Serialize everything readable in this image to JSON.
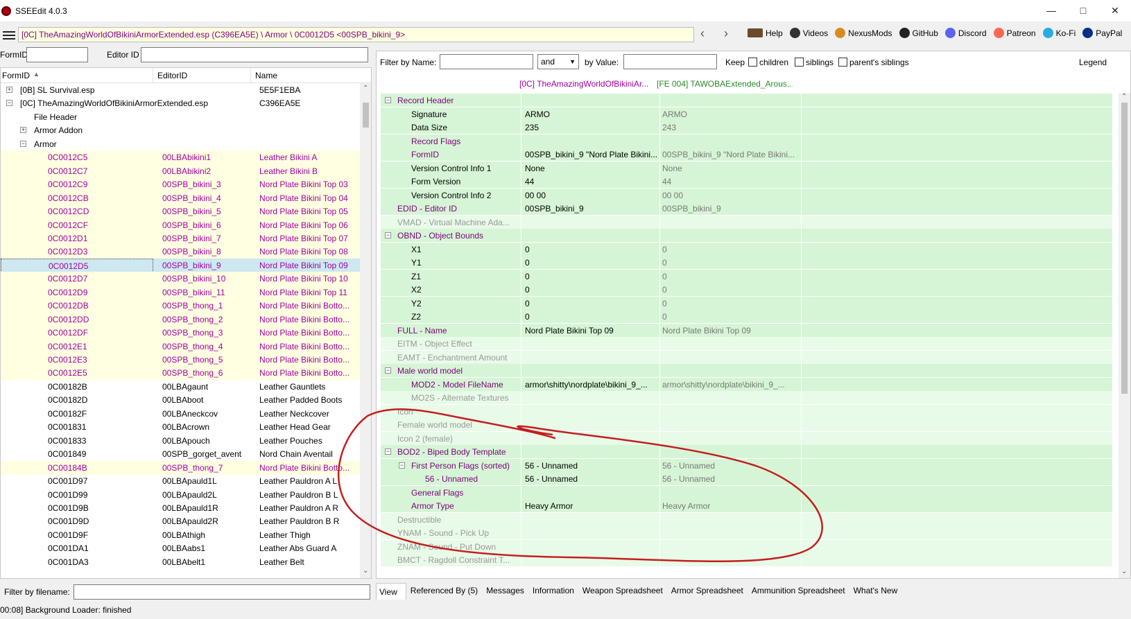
{
  "window": {
    "title": "SSEEdit 4.0.3"
  },
  "toolbar": {
    "path": "[0C] TheAmazingWorldOfBikiniArmorExtended.esp (C396EA5E) \\ Armor \\ 0C0012D5 <00SPB_bikini_9>",
    "links": [
      {
        "label": "Help",
        "icon": "book-icon",
        "color": "#6b4a2b"
      },
      {
        "label": "Videos",
        "icon": "video-icon",
        "color": "#333333"
      },
      {
        "label": "NexusMods",
        "icon": "nexus-icon",
        "color": "#d98c1e"
      },
      {
        "label": "GitHub",
        "icon": "github-icon",
        "color": "#222222"
      },
      {
        "label": "Discord",
        "icon": "discord-icon",
        "color": "#5865f2"
      },
      {
        "label": "Patreon",
        "icon": "patreon-icon",
        "color": "#f96854"
      },
      {
        "label": "Ko-Fi",
        "icon": "kofi-icon",
        "color": "#29abe0"
      },
      {
        "label": "PayPal",
        "icon": "paypal-icon",
        "color": "#003087"
      }
    ]
  },
  "left_filter": {
    "formid_label": "FormID",
    "editorid_label": "Editor ID"
  },
  "tree": {
    "columns": [
      "FormID",
      "EditorID",
      "Name"
    ],
    "rows": [
      {
        "c1": "[0B] SL Survival.esp",
        "c2": "",
        "c3": "5E5F1EBA",
        "level": 0,
        "exp": "+",
        "style": ""
      },
      {
        "c1": "[0C] TheAmazingWorldOfBikiniArmorExtended.esp",
        "c2": "",
        "c3": "C396EA5E",
        "level": 0,
        "exp": "−",
        "style": ""
      },
      {
        "c1": "File Header",
        "c2": "",
        "c3": "",
        "level": 1,
        "exp": "",
        "style": ""
      },
      {
        "c1": "Armor Addon",
        "c2": "",
        "c3": "",
        "level": 1,
        "exp": "+",
        "style": ""
      },
      {
        "c1": "Armor",
        "c2": "",
        "c3": "",
        "level": 1,
        "exp": "−",
        "style": ""
      },
      {
        "c1": "0C0012C5",
        "c2": "00LBAbikini1",
        "c3": "Leather Bikini A",
        "level": 2,
        "style": "yel pur"
      },
      {
        "c1": "0C0012C7",
        "c2": "00LBAbikini2",
        "c3": "Leather Bikini B",
        "level": 2,
        "style": "yel pur"
      },
      {
        "c1": "0C0012C9",
        "c2": "00SPB_bikini_3",
        "c3": "Nord Plate Bikini Top 03",
        "level": 2,
        "style": "yel pur"
      },
      {
        "c1": "0C0012CB",
        "c2": "00SPB_bikini_4",
        "c3": "Nord Plate Bikini Top 04",
        "level": 2,
        "style": "yel pur"
      },
      {
        "c1": "0C0012CD",
        "c2": "00SPB_bikini_5",
        "c3": "Nord Plate Bikini Top 05",
        "level": 2,
        "style": "yel pur"
      },
      {
        "c1": "0C0012CF",
        "c2": "00SPB_bikini_6",
        "c3": "Nord Plate Bikini Top 06",
        "level": 2,
        "style": "yel pur"
      },
      {
        "c1": "0C0012D1",
        "c2": "00SPB_bikini_7",
        "c3": "Nord Plate Bikini Top 07",
        "level": 2,
        "style": "yel pur"
      },
      {
        "c1": "0C0012D3",
        "c2": "00SPB_bikini_8",
        "c3": "Nord Plate Bikini Top 08",
        "level": 2,
        "style": "yel pur"
      },
      {
        "c1": "0C0012D5",
        "c2": "00SPB_bikini_9",
        "c3": "Nord Plate Bikini Top 09",
        "level": 2,
        "style": "sel pur"
      },
      {
        "c1": "0C0012D7",
        "c2": "00SPB_bikini_10",
        "c3": "Nord Plate Bikini Top 10",
        "level": 2,
        "style": "yel pur"
      },
      {
        "c1": "0C0012D9",
        "c2": "00SPB_bikini_11",
        "c3": "Nord Plate Bikini Top 11",
        "level": 2,
        "style": "yel pur"
      },
      {
        "c1": "0C0012DB",
        "c2": "00SPB_thong_1",
        "c3": "Nord Plate Bikini Botto...",
        "level": 2,
        "style": "yel pur"
      },
      {
        "c1": "0C0012DD",
        "c2": "00SPB_thong_2",
        "c3": "Nord Plate Bikini Botto...",
        "level": 2,
        "style": "yel pur"
      },
      {
        "c1": "0C0012DF",
        "c2": "00SPB_thong_3",
        "c3": "Nord Plate Bikini Botto...",
        "level": 2,
        "style": "yel pur"
      },
      {
        "c1": "0C0012E1",
        "c2": "00SPB_thong_4",
        "c3": "Nord Plate Bikini Botto...",
        "level": 2,
        "style": "yel pur"
      },
      {
        "c1": "0C0012E3",
        "c2": "00SPB_thong_5",
        "c3": "Nord Plate Bikini Botto...",
        "level": 2,
        "style": "yel pur"
      },
      {
        "c1": "0C0012E5",
        "c2": "00SPB_thong_6",
        "c3": "Nord Plate Bikini Botto...",
        "level": 2,
        "style": "yel pur"
      },
      {
        "c1": "0C00182B",
        "c2": "00LBAgaunt",
        "c3": "Leather Gauntlets",
        "level": 2,
        "style": ""
      },
      {
        "c1": "0C00182D",
        "c2": "00LBAboot",
        "c3": "Leather Padded Boots",
        "level": 2,
        "style": ""
      },
      {
        "c1": "0C00182F",
        "c2": "00LBAneckcov",
        "c3": "Leather Neckcover",
        "level": 2,
        "style": ""
      },
      {
        "c1": "0C001831",
        "c2": "00LBAcrown",
        "c3": "Leather Head Gear",
        "level": 2,
        "style": ""
      },
      {
        "c1": "0C001833",
        "c2": "00LBApouch",
        "c3": "Leather Pouches",
        "level": 2,
        "style": ""
      },
      {
        "c1": "0C001849",
        "c2": "00SPB_gorget_avent",
        "c3": "Nord Chain Aventail",
        "level": 2,
        "style": ""
      },
      {
        "c1": "0C00184B",
        "c2": "00SPB_thong_7",
        "c3": "Nord Plate Bikini Botto...",
        "level": 2,
        "style": "yel pur"
      },
      {
        "c1": "0C001D97",
        "c2": "00LBApauld1L",
        "c3": "Leather Pauldron A L",
        "level": 2,
        "style": ""
      },
      {
        "c1": "0C001D99",
        "c2": "00LBApauld2L",
        "c3": "Leather Pauldron B L",
        "level": 2,
        "style": ""
      },
      {
        "c1": "0C001D9B",
        "c2": "00LBApauld1R",
        "c3": "Leather Pauldron A R",
        "level": 2,
        "style": ""
      },
      {
        "c1": "0C001D9D",
        "c2": "00LBApauld2R",
        "c3": "Leather Pauldron B R",
        "level": 2,
        "style": ""
      },
      {
        "c1": "0C001D9F",
        "c2": "00LBAthigh",
        "c3": "Leather Thigh",
        "level": 2,
        "style": ""
      },
      {
        "c1": "0C001DA1",
        "c2": "00LBAabs1",
        "c3": "Leather Abs Guard A",
        "level": 2,
        "style": ""
      },
      {
        "c1": "0C001DA3",
        "c2": "00LBAbelt1",
        "c3": "Leather Belt",
        "level": 2,
        "style": ""
      }
    ]
  },
  "filter_bar": {
    "by_name_label": "Filter by Name:",
    "op_value": "and",
    "by_value_label": "by Value:",
    "keep_label": "Keep",
    "children_label": "children",
    "siblings_label": "siblings",
    "parents_siblings_label": "parent's siblings",
    "legend_label": "Legend"
  },
  "view": {
    "col_headers": [
      "[0C] TheAmazingWorldOfBikiniAr...",
      "[FE 004] TAWOBAExtended_Arous..."
    ],
    "rows": [
      {
        "label": "Record Header",
        "v1": "",
        "v2": "",
        "level": 0,
        "exp": "−",
        "dim": false
      },
      {
        "label": "Signature",
        "v1": "ARMO",
        "v2": "ARMO",
        "level": 1,
        "dim": false,
        "black": true
      },
      {
        "label": "Data Size",
        "v1": "235",
        "v2": "243",
        "level": 1,
        "dim": false,
        "black": true
      },
      {
        "label": "Record Flags",
        "v1": "",
        "v2": "",
        "level": 1,
        "dim": false
      },
      {
        "label": "FormID",
        "v1": "00SPB_bikini_9 \"Nord Plate Bikini...",
        "v2": "00SPB_bikini_9 \"Nord Plate Bikini...",
        "level": 1,
        "dim": false
      },
      {
        "label": "Version Control Info 1",
        "v1": "None",
        "v2": "None",
        "level": 1,
        "dim": false,
        "black": true
      },
      {
        "label": "Form Version",
        "v1": "44",
        "v2": "44",
        "level": 1,
        "dim": false,
        "black": true
      },
      {
        "label": "Version Control Info 2",
        "v1": "00 00",
        "v2": "00 00",
        "level": 1,
        "dim": false,
        "black": true
      },
      {
        "label": "EDID - Editor ID",
        "v1": "00SPB_bikini_9",
        "v2": "00SPB_bikini_9",
        "level": 0,
        "dim": false
      },
      {
        "label": "VMAD - Virtual Machine Ada...",
        "v1": "",
        "v2": "",
        "level": 0,
        "dim": true
      },
      {
        "label": "OBND - Object Bounds",
        "v1": "",
        "v2": "",
        "level": 0,
        "exp": "−",
        "dim": false
      },
      {
        "label": "X1",
        "v1": "0",
        "v2": "0",
        "level": 1,
        "dim": false,
        "black": true
      },
      {
        "label": "Y1",
        "v1": "0",
        "v2": "0",
        "level": 1,
        "dim": false,
        "black": true
      },
      {
        "label": "Z1",
        "v1": "0",
        "v2": "0",
        "level": 1,
        "dim": false,
        "black": true
      },
      {
        "label": "X2",
        "v1": "0",
        "v2": "0",
        "level": 1,
        "dim": false,
        "black": true
      },
      {
        "label": "Y2",
        "v1": "0",
        "v2": "0",
        "level": 1,
        "dim": false,
        "black": true
      },
      {
        "label": "Z2",
        "v1": "0",
        "v2": "0",
        "level": 1,
        "dim": false,
        "black": true
      },
      {
        "label": "FULL - Name",
        "v1": "Nord Plate Bikini Top 09",
        "v2": "Nord Plate Bikini Top 09",
        "level": 0,
        "dim": false
      },
      {
        "label": "EITM - Object Effect",
        "v1": "",
        "v2": "",
        "level": 0,
        "dim": true
      },
      {
        "label": "EAMT - Enchantment Amount",
        "v1": "",
        "v2": "",
        "level": 0,
        "dim": true
      },
      {
        "label": "Male world model",
        "v1": "",
        "v2": "",
        "level": 0,
        "exp": "−",
        "dim": false
      },
      {
        "label": "MOD2 - Model FileName",
        "v1": "armor\\shitty\\nordplate\\bikini_9_...",
        "v2": "armor\\shitty\\nordplate\\bikini_9_...",
        "level": 1,
        "dim": false
      },
      {
        "label": "MO2S - Alternate Textures",
        "v1": "",
        "v2": "",
        "level": 1,
        "dim": true
      },
      {
        "label": "Icon",
        "v1": "",
        "v2": "",
        "level": 0,
        "dim": true
      },
      {
        "label": "Female world model",
        "v1": "",
        "v2": "",
        "level": 0,
        "dim": true
      },
      {
        "label": "Icon 2 (female)",
        "v1": "",
        "v2": "",
        "level": 0,
        "dim": true
      },
      {
        "label": "BOD2 - Biped Body Template",
        "v1": "",
        "v2": "",
        "level": 0,
        "exp": "−",
        "dim": false
      },
      {
        "label": "First Person Flags (sorted)",
        "v1": "56 - Unnamed",
        "v2": "56 - Unnamed",
        "level": 1,
        "exp": "−",
        "dim": false
      },
      {
        "label": "56 - Unnamed",
        "v1": "56 - Unnamed",
        "v2": "56 - Unnamed",
        "level": 2,
        "dim": false
      },
      {
        "label": "General Flags",
        "v1": "",
        "v2": "",
        "level": 1,
        "dim": false
      },
      {
        "label": "Armor Type",
        "v1": "Heavy Armor",
        "v2": "Heavy Armor",
        "level": 1,
        "dim": false
      },
      {
        "label": "Destructible",
        "v1": "",
        "v2": "",
        "level": 0,
        "dim": true
      },
      {
        "label": "YNAM - Sound - Pick Up",
        "v1": "",
        "v2": "",
        "level": 0,
        "dim": true
      },
      {
        "label": "ZNAM - Sound - Put Down",
        "v1": "",
        "v2": "",
        "level": 0,
        "dim": true
      },
      {
        "label": "BMCT - Ragdoll Constraint T...",
        "v1": "",
        "v2": "",
        "level": 0,
        "dim": true
      }
    ]
  },
  "tabs": [
    "View",
    "Referenced By (5)",
    "Messages",
    "Information",
    "Weapon Spreadsheet",
    "Armor Spreadsheet",
    "Ammunition Spreadsheet",
    "What's New"
  ],
  "bottom_filter": {
    "label": "Filter by filename:"
  },
  "status": {
    "text": "00:08] Background Loader: finished"
  },
  "annotation_color": "#c41e1e"
}
